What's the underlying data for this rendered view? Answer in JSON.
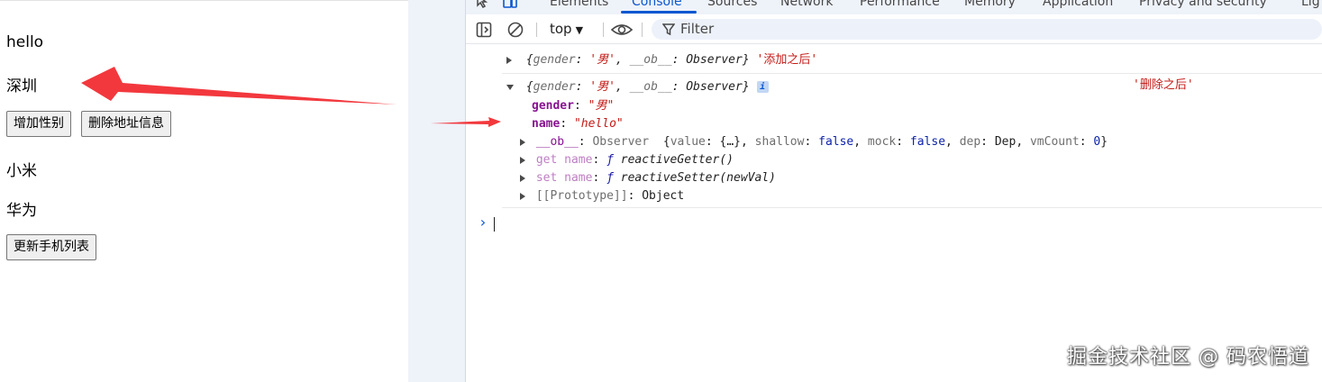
{
  "page": {
    "name_text": "hello",
    "address_text": "深圳",
    "add_gender_button": "增加性别",
    "delete_address_button": "删除地址信息",
    "phones": [
      "小米",
      "华为"
    ],
    "update_phones_button": "更新手机列表"
  },
  "devtools": {
    "tabs": [
      "Elements",
      "Console",
      "Sources",
      "Network",
      "Performance",
      "Memory",
      "Application",
      "Privacy and security",
      "Lig"
    ],
    "active_tab": "Console",
    "toolbar": {
      "context": "top",
      "filter_placeholder": "Filter"
    },
    "console": {
      "msg1": {
        "preview_open": "{",
        "gender_key": "gender",
        "gender_val": "'男'",
        "ob_key": "__ob__",
        "ob_val": "Observer",
        "preview_close": "}",
        "log_text": "'添加之后'"
      },
      "msg2": {
        "preview_open": "{",
        "gender_key": "gender",
        "gender_val": "'男'",
        "ob_key": "__ob__",
        "ob_val": "Observer",
        "preview_close": "}",
        "info": "i",
        "log_text": "'删除之后'",
        "props": {
          "gender_key": "gender",
          "gender_val": "\"男\"",
          "name_key": "name",
          "name_val": "\"hello\""
        },
        "ob_row": {
          "key": "__ob__",
          "type": "Observer",
          "preview": "{value: {…}, shallow: false, mock: false, dep: Dep, vmCount: 0}",
          "p_value": "value",
          "p_value_v": "{…}",
          "p_shallow": "shallow",
          "p_shallow_v": "false",
          "p_mock": "mock",
          "p_mock_v": "false",
          "p_dep": "dep",
          "p_dep_v": "Dep",
          "p_vm": "vmCount",
          "p_vm_v": "0"
        },
        "getter": {
          "label": "get name",
          "f": "ƒ",
          "fn": "reactiveGetter()"
        },
        "setter": {
          "label": "set name",
          "f": "ƒ",
          "fn": "reactiveSetter(newVal)"
        },
        "proto": {
          "key": "[[Prototype]]",
          "val": "Object"
        }
      },
      "prompt": "›"
    }
  },
  "watermark": "掘金技术社区 @ 码农悟道",
  "colors": {
    "accent": "#0b57d0",
    "arrow": "#f2383d",
    "string": "#c41a16",
    "key": "#881391"
  }
}
